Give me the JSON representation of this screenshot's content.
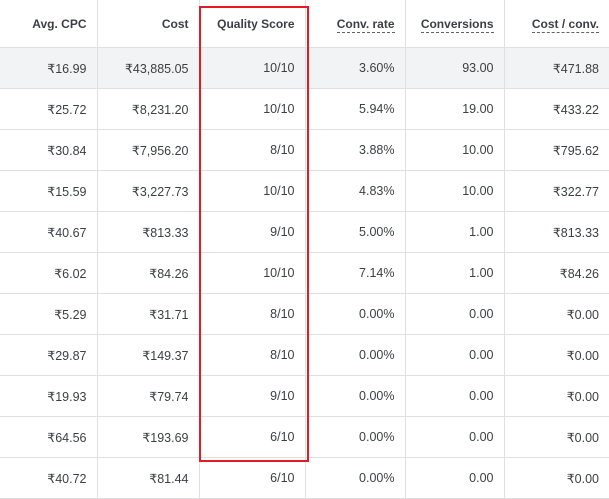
{
  "headers": {
    "avg_cpc": "Avg. CPC",
    "cost": "Cost",
    "quality_score": "Quality Score",
    "conv_rate": "Conv. rate",
    "conversions": "Conversions",
    "cost_per_conv": "Cost / conv."
  },
  "rows": [
    {
      "avg_cpc": "₹16.99",
      "cost": "₹43,885.05",
      "quality_score": "10/10",
      "conv_rate": "3.60%",
      "conversions": "93.00",
      "cost_per_conv": "₹471.88"
    },
    {
      "avg_cpc": "₹25.72",
      "cost": "₹8,231.20",
      "quality_score": "10/10",
      "conv_rate": "5.94%",
      "conversions": "19.00",
      "cost_per_conv": "₹433.22"
    },
    {
      "avg_cpc": "₹30.84",
      "cost": "₹7,956.20",
      "quality_score": "8/10",
      "conv_rate": "3.88%",
      "conversions": "10.00",
      "cost_per_conv": "₹795.62"
    },
    {
      "avg_cpc": "₹15.59",
      "cost": "₹3,227.73",
      "quality_score": "10/10",
      "conv_rate": "4.83%",
      "conversions": "10.00",
      "cost_per_conv": "₹322.77"
    },
    {
      "avg_cpc": "₹40.67",
      "cost": "₹813.33",
      "quality_score": "9/10",
      "conv_rate": "5.00%",
      "conversions": "1.00",
      "cost_per_conv": "₹813.33"
    },
    {
      "avg_cpc": "₹6.02",
      "cost": "₹84.26",
      "quality_score": "10/10",
      "conv_rate": "7.14%",
      "conversions": "1.00",
      "cost_per_conv": "₹84.26"
    },
    {
      "avg_cpc": "₹5.29",
      "cost": "₹31.71",
      "quality_score": "8/10",
      "conv_rate": "0.00%",
      "conversions": "0.00",
      "cost_per_conv": "₹0.00"
    },
    {
      "avg_cpc": "₹29.87",
      "cost": "₹149.37",
      "quality_score": "8/10",
      "conv_rate": "0.00%",
      "conversions": "0.00",
      "cost_per_conv": "₹0.00"
    },
    {
      "avg_cpc": "₹19.93",
      "cost": "₹79.74",
      "quality_score": "9/10",
      "conv_rate": "0.00%",
      "conversions": "0.00",
      "cost_per_conv": "₹0.00"
    },
    {
      "avg_cpc": "₹64.56",
      "cost": "₹193.69",
      "quality_score": "6/10",
      "conv_rate": "0.00%",
      "conversions": "0.00",
      "cost_per_conv": "₹0.00"
    },
    {
      "avg_cpc": "₹40.72",
      "cost": "₹81.44",
      "quality_score": "6/10",
      "conv_rate": "0.00%",
      "conversions": "0.00",
      "cost_per_conv": "₹0.00"
    }
  ],
  "highlight_color": "#e31b23"
}
